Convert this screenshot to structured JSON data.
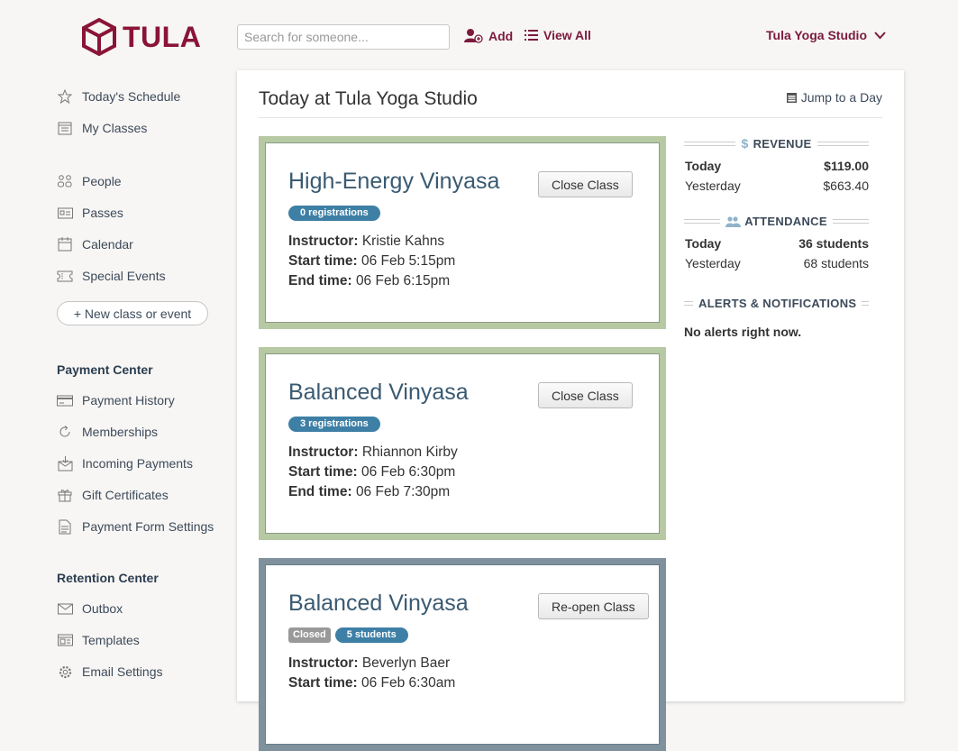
{
  "brand": {
    "name": "TULA",
    "color": "#8a1438"
  },
  "header": {
    "search_placeholder": "Search for someone...",
    "add_label": "Add",
    "view_all_label": "View All",
    "studio_label": "Tula Yoga Studio"
  },
  "sidebar": {
    "primary": [
      {
        "label": "Today's Schedule",
        "icon": "star-icon"
      },
      {
        "label": "My Classes",
        "icon": "calendar-list-icon"
      }
    ],
    "secondary": [
      {
        "label": "People",
        "icon": "people-icon"
      },
      {
        "label": "Passes",
        "icon": "id-card-icon"
      },
      {
        "label": "Calendar",
        "icon": "calendar-icon"
      },
      {
        "label": "Special Events",
        "icon": "ticket-icon"
      }
    ],
    "new_button": "+ New class or event",
    "payment_heading": "Payment Center",
    "payment_items": [
      {
        "label": "Payment History",
        "icon": "credit-card-icon"
      },
      {
        "label": "Memberships",
        "icon": "refresh-icon"
      },
      {
        "label": "Incoming Payments",
        "icon": "inbox-icon"
      },
      {
        "label": "Gift Certificates",
        "icon": "gift-icon"
      },
      {
        "label": "Payment Form Settings",
        "icon": "document-icon"
      }
    ],
    "retention_heading": "Retention Center",
    "retention_items": [
      {
        "label": "Outbox",
        "icon": "envelope-icon"
      },
      {
        "label": "Templates",
        "icon": "template-icon"
      },
      {
        "label": "Email Settings",
        "icon": "gear-icon"
      }
    ]
  },
  "main": {
    "title": "Today at Tula Yoga Studio",
    "jump_label": "Jump to a Day",
    "classes": [
      {
        "title": "High-Energy Vinyasa",
        "button": "Close Class",
        "badges": [
          {
            "text": "0 registrations",
            "style": "blue"
          }
        ],
        "instructor_label": "Instructor:",
        "instructor": "Kristie Kahns",
        "start_label": "Start time:",
        "start": "06 Feb 5:15pm",
        "end_label": "End time:",
        "end": "06 Feb 6:15pm"
      },
      {
        "title": "Balanced Vinyasa",
        "button": "Close Class",
        "badges": [
          {
            "text": "3 registrations",
            "style": "blue"
          }
        ],
        "instructor_label": "Instructor:",
        "instructor": "Rhiannon Kirby",
        "start_label": "Start time:",
        "start": "06 Feb 6:30pm",
        "end_label": "End time:",
        "end": "06 Feb 7:30pm"
      },
      {
        "title": "Balanced Vinyasa",
        "button": "Re-open Class",
        "badges": [
          {
            "text": "Closed",
            "style": "gray"
          },
          {
            "text": "5 students",
            "style": "blue"
          }
        ],
        "instructor_label": "Instructor:",
        "instructor": "Beverlyn Baer",
        "start_label": "Start time:",
        "start": "06 Feb 6:30am"
      }
    ]
  },
  "stats": {
    "revenue_heading": "REVENUE",
    "revenue": [
      {
        "label": "Today",
        "value": "$119.00"
      },
      {
        "label": "Yesterday",
        "value": "$663.40"
      }
    ],
    "attendance_heading": "ATTENDANCE",
    "attendance": [
      {
        "label": "Today",
        "value": "36 students"
      },
      {
        "label": "Yesterday",
        "value": "68 students"
      }
    ],
    "alerts_heading": "ALERTS & NOTIFICATIONS",
    "alerts_text": "No alerts right now."
  }
}
